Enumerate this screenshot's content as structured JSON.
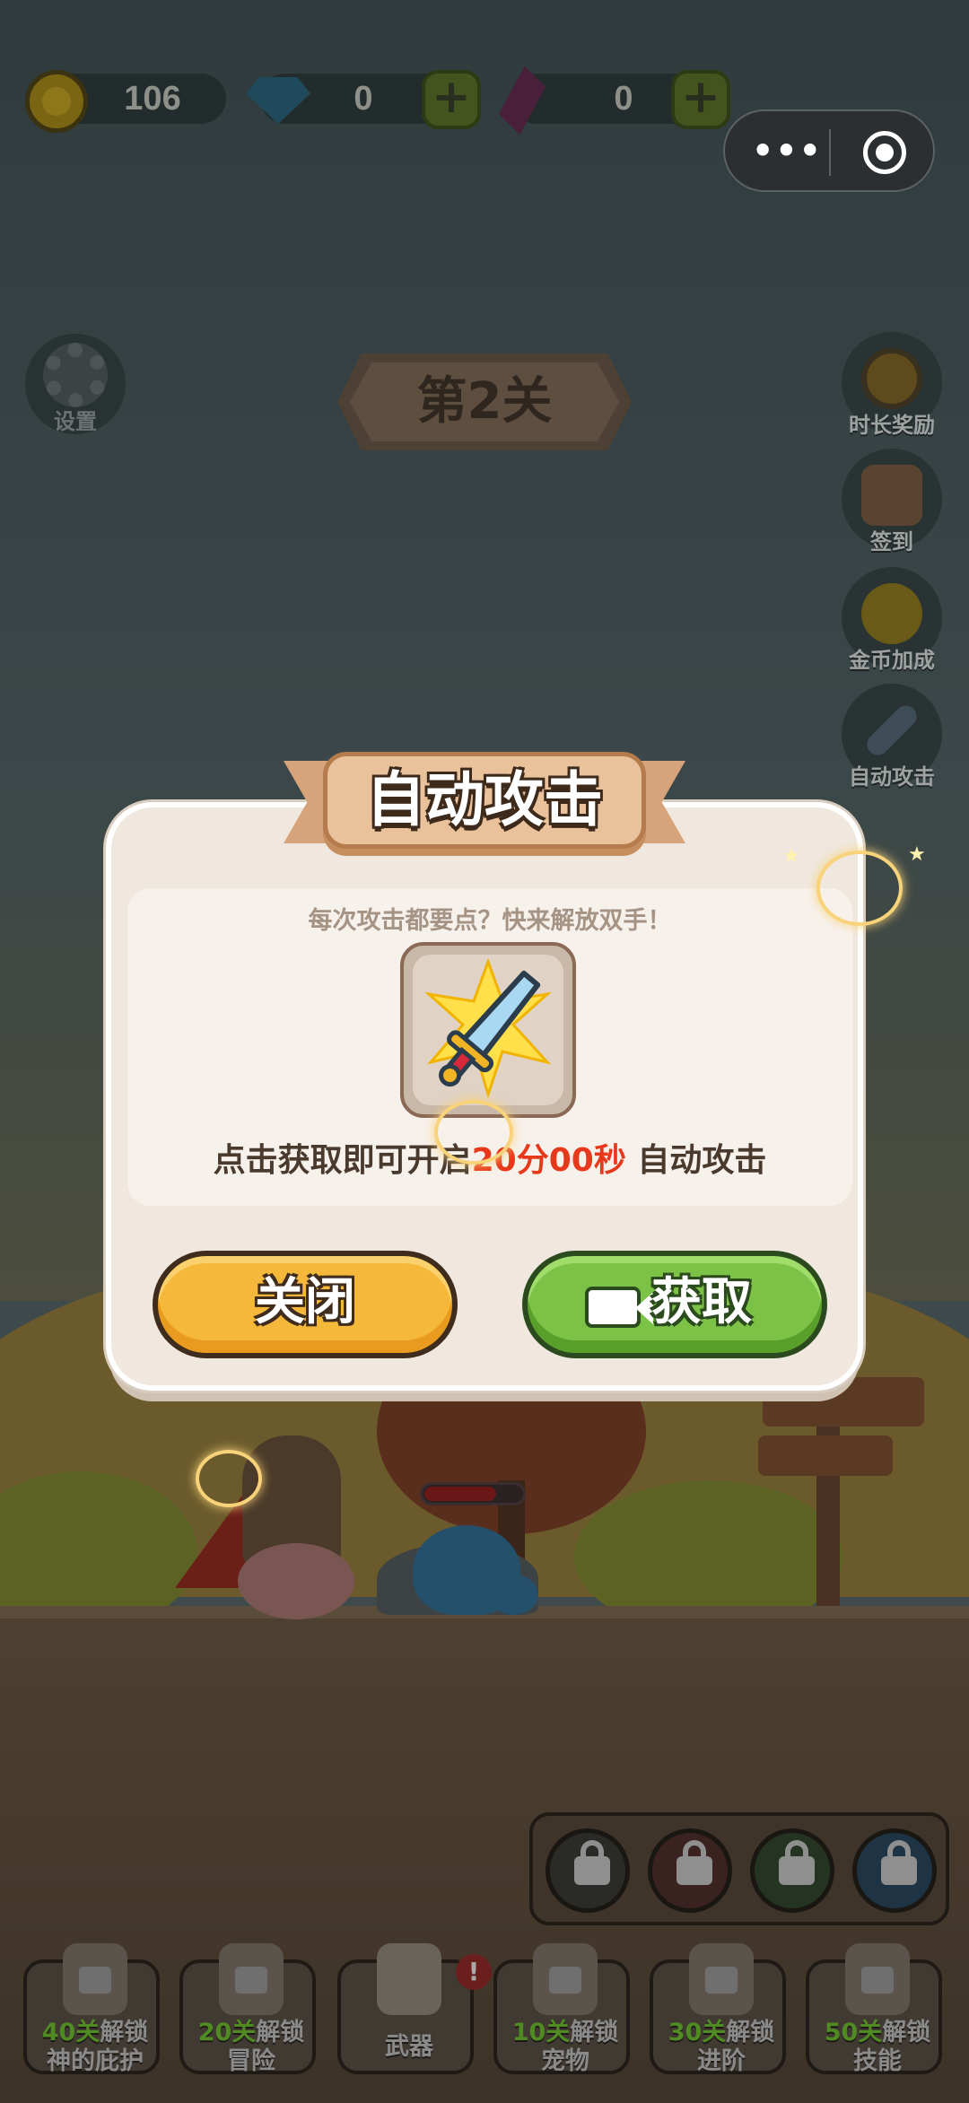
{
  "currency": {
    "coins": "106",
    "gems": "0",
    "crystals": "0"
  },
  "settings": {
    "label": "设置"
  },
  "level": {
    "title": "第2关"
  },
  "side_buttons": [
    {
      "label": "时长奖励",
      "icon": "stopwatch-icon"
    },
    {
      "label": "签到",
      "icon": "clipboard-check-icon"
    },
    {
      "label": "金币加成",
      "icon": "gold-coins-icon"
    },
    {
      "label": "自动攻击",
      "icon": "sword-icon"
    }
  ],
  "modal": {
    "title": "自动攻击",
    "subtitle": "每次攻击都要点？快来解放双手！",
    "desc_prefix": "点击获取即可开启",
    "desc_time": "20分00秒",
    "desc_suffix": "自动攻击",
    "close_label": "关闭",
    "get_label": "获取"
  },
  "bottom_nav": [
    {
      "hl": "40关",
      "rest": "解锁",
      "line2": "神的庇护"
    },
    {
      "hl": "20关",
      "rest": "解锁",
      "line2": "冒险"
    },
    {
      "hl": "",
      "rest": "",
      "line2": "武器",
      "alert": "!"
    },
    {
      "hl": "10关",
      "rest": "解锁",
      "line2": "宠物"
    },
    {
      "hl": "30关",
      "rest": "解锁",
      "line2": "进阶"
    },
    {
      "hl": "50关",
      "rest": "解锁",
      "line2": "技能"
    }
  ],
  "colors": {
    "accent_yellow": "#f6b83a",
    "accent_green": "#7cc246",
    "highlight_red": "#e8381b"
  }
}
